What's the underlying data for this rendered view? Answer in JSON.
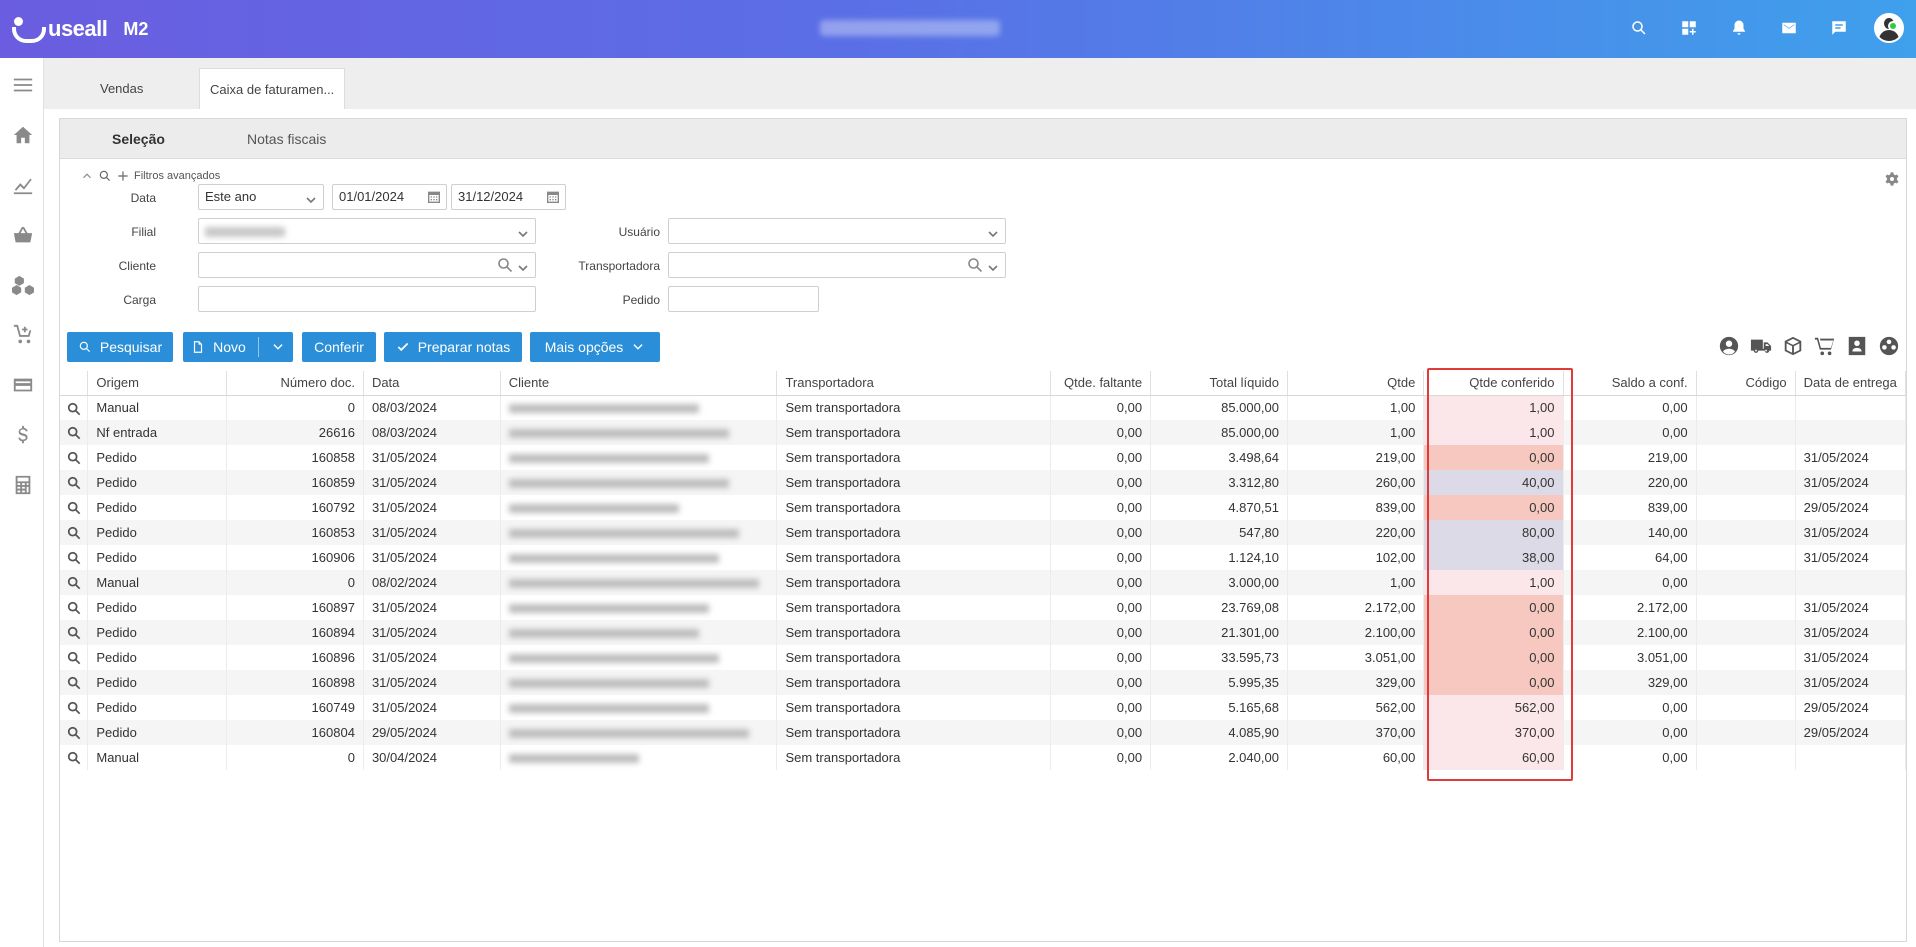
{
  "app": {
    "brand": "useall",
    "brand_suffix": "M2"
  },
  "top_icons": [
    "search-icon",
    "apps-icon",
    "bell-icon",
    "mail-icon",
    "chat-icon"
  ],
  "page_tabs": [
    {
      "label": "Vendas"
    },
    {
      "label": "Caixa de faturamen..."
    }
  ],
  "subtabs": [
    {
      "label": "Seleção"
    },
    {
      "label": "Notas fiscais"
    }
  ],
  "filters": {
    "header": "Filtros avançados",
    "data_label": "Data",
    "data_period": "Este ano",
    "date_from": "01/01/2024",
    "date_to": "31/12/2024",
    "filial_label": "Filial",
    "cliente_label": "Cliente",
    "carga_label": "Carga",
    "usuario_label": "Usuário",
    "transportadora_label": "Transportadora",
    "pedido_label": "Pedido"
  },
  "buttons": {
    "pesquisar": "Pesquisar",
    "novo": "Novo",
    "conferir": "Conferir",
    "preparar": "Preparar notas",
    "mais": "Mais opções"
  },
  "grid": {
    "columns": [
      "Origem",
      "Número doc.",
      "Data",
      "Cliente",
      "Transportadora",
      "Qtde. faltante",
      "Total líquido",
      "Qtde",
      "Qtde conferido",
      "Saldo a conf.",
      "Código",
      "Data de entrega"
    ],
    "rows": [
      {
        "origem": "Manual",
        "numero": "0",
        "data": "08/03/2024",
        "transp": "Sem transportadora",
        "faltante": "0,00",
        "total": "85.000,00",
        "qtde": "1,00",
        "conferido": "1,00",
        "status": "done",
        "saldo": "0,00",
        "codigo": "",
        "entrega": ""
      },
      {
        "origem": "Nf entrada",
        "numero": "26616",
        "data": "08/03/2024",
        "transp": "Sem transportadora",
        "faltante": "0,00",
        "total": "85.000,00",
        "qtde": "1,00",
        "conferido": "1,00",
        "status": "done",
        "saldo": "0,00",
        "codigo": "",
        "entrega": ""
      },
      {
        "origem": "Pedido",
        "numero": "160858",
        "data": "31/05/2024",
        "transp": "Sem transportadora",
        "faltante": "0,00",
        "total": "3.498,64",
        "qtde": "219,00",
        "conferido": "0,00",
        "status": "zero",
        "saldo": "219,00",
        "codigo": "",
        "entrega": "31/05/2024"
      },
      {
        "origem": "Pedido",
        "numero": "160859",
        "data": "31/05/2024",
        "transp": "Sem transportadora",
        "faltante": "0,00",
        "total": "3.312,80",
        "qtde": "260,00",
        "conferido": "40,00",
        "status": "part",
        "saldo": "220,00",
        "codigo": "",
        "entrega": "31/05/2024"
      },
      {
        "origem": "Pedido",
        "numero": "160792",
        "data": "31/05/2024",
        "transp": "Sem transportadora",
        "faltante": "0,00",
        "total": "4.870,51",
        "qtde": "839,00",
        "conferido": "0,00",
        "status": "zero",
        "saldo": "839,00",
        "codigo": "",
        "entrega": "29/05/2024"
      },
      {
        "origem": "Pedido",
        "numero": "160853",
        "data": "31/05/2024",
        "transp": "Sem transportadora",
        "faltante": "0,00",
        "total": "547,80",
        "qtde": "220,00",
        "conferido": "80,00",
        "status": "part",
        "saldo": "140,00",
        "codigo": "",
        "entrega": "31/05/2024"
      },
      {
        "origem": "Pedido",
        "numero": "160906",
        "data": "31/05/2024",
        "transp": "Sem transportadora",
        "faltante": "0,00",
        "total": "1.124,10",
        "qtde": "102,00",
        "conferido": "38,00",
        "status": "part",
        "saldo": "64,00",
        "codigo": "",
        "entrega": "31/05/2024"
      },
      {
        "origem": "Manual",
        "numero": "0",
        "data": "08/02/2024",
        "transp": "Sem transportadora",
        "faltante": "0,00",
        "total": "3.000,00",
        "qtde": "1,00",
        "conferido": "1,00",
        "status": "done",
        "saldo": "0,00",
        "codigo": "",
        "entrega": ""
      },
      {
        "origem": "Pedido",
        "numero": "160897",
        "data": "31/05/2024",
        "transp": "Sem transportadora",
        "faltante": "0,00",
        "total": "23.769,08",
        "qtde": "2.172,00",
        "conferido": "0,00",
        "status": "zero",
        "saldo": "2.172,00",
        "codigo": "",
        "entrega": "31/05/2024"
      },
      {
        "origem": "Pedido",
        "numero": "160894",
        "data": "31/05/2024",
        "transp": "Sem transportadora",
        "faltante": "0,00",
        "total": "21.301,00",
        "qtde": "2.100,00",
        "conferido": "0,00",
        "status": "zero",
        "saldo": "2.100,00",
        "codigo": "",
        "entrega": "31/05/2024"
      },
      {
        "origem": "Pedido",
        "numero": "160896",
        "data": "31/05/2024",
        "transp": "Sem transportadora",
        "faltante": "0,00",
        "total": "33.595,73",
        "qtde": "3.051,00",
        "conferido": "0,00",
        "status": "zero",
        "saldo": "3.051,00",
        "codigo": "",
        "entrega": "31/05/2024"
      },
      {
        "origem": "Pedido",
        "numero": "160898",
        "data": "31/05/2024",
        "transp": "Sem transportadora",
        "faltante": "0,00",
        "total": "5.995,35",
        "qtde": "329,00",
        "conferido": "0,00",
        "status": "zero",
        "saldo": "329,00",
        "codigo": "",
        "entrega": "31/05/2024"
      },
      {
        "origem": "Pedido",
        "numero": "160749",
        "data": "31/05/2024",
        "transp": "Sem transportadora",
        "faltante": "0,00",
        "total": "5.165,68",
        "qtde": "562,00",
        "conferido": "562,00",
        "status": "done",
        "saldo": "0,00",
        "codigo": "",
        "entrega": "29/05/2024"
      },
      {
        "origem": "Pedido",
        "numero": "160804",
        "data": "29/05/2024",
        "transp": "Sem transportadora",
        "faltante": "0,00",
        "total": "4.085,90",
        "qtde": "370,00",
        "conferido": "370,00",
        "status": "done",
        "saldo": "0,00",
        "codigo": "",
        "entrega": "29/05/2024"
      },
      {
        "origem": "Manual",
        "numero": "0",
        "data": "30/04/2024",
        "transp": "Sem transportadora",
        "faltante": "0,00",
        "total": "2.040,00",
        "qtde": "60,00",
        "conferido": "60,00",
        "status": "done",
        "saldo": "0,00",
        "codigo": "",
        "entrega": ""
      }
    ]
  },
  "colors": {
    "brand_gradient_start": "#6a5de0",
    "brand_gradient_end": "#3fa0ec",
    "button_blue": "#2a8fd8",
    "highlight_red": "#e03a3a"
  }
}
